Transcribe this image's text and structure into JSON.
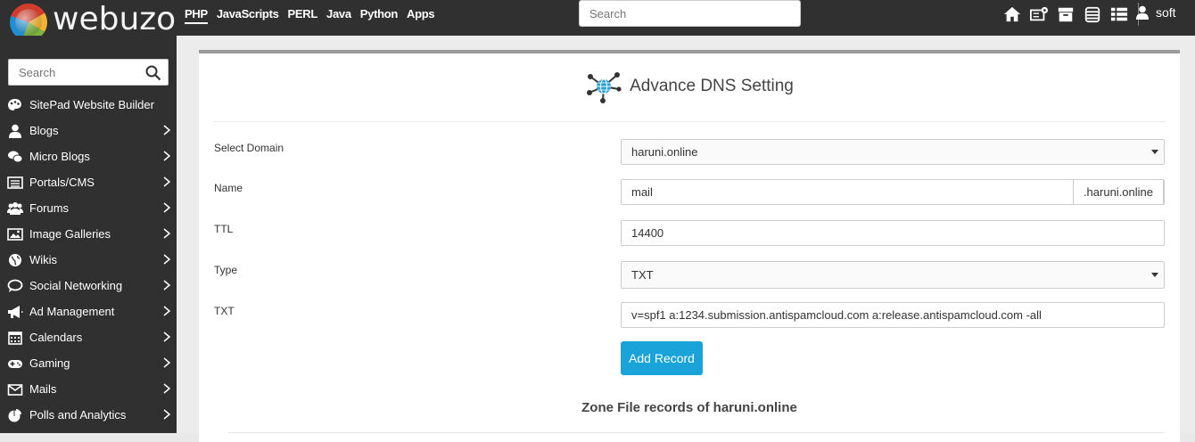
{
  "brand": {
    "name": "webuzo"
  },
  "topnav": {
    "items": [
      {
        "label": "PHP",
        "active": true
      },
      {
        "label": "JavaScripts",
        "active": false
      },
      {
        "label": "PERL",
        "active": false
      },
      {
        "label": "Java",
        "active": false
      },
      {
        "label": "Python",
        "active": false
      },
      {
        "label": "Apps",
        "active": false
      }
    ],
    "search_placeholder": "Search",
    "icons": [
      "home-icon",
      "server-config-icon",
      "archive-box-icon",
      "database-icon",
      "list-icon"
    ],
    "user": {
      "name": "soft",
      "icon": "user-icon"
    }
  },
  "sidebar": {
    "search_placeholder": "Search",
    "items": [
      {
        "label": "SitePad Website Builder",
        "icon": "palette-icon",
        "has_children": false
      },
      {
        "label": "Blogs",
        "icon": "user-icon",
        "has_children": true
      },
      {
        "label": "Micro Blogs",
        "icon": "chat-icon",
        "has_children": true
      },
      {
        "label": "Portals/CMS",
        "icon": "list-box-icon",
        "has_children": true
      },
      {
        "label": "Forums",
        "icon": "users-icon",
        "has_children": true
      },
      {
        "label": "Image Galleries",
        "icon": "image-icon",
        "has_children": true
      },
      {
        "label": "Wikis",
        "icon": "globe-icon",
        "has_children": true
      },
      {
        "label": "Social Networking",
        "icon": "comment-icon",
        "has_children": true
      },
      {
        "label": "Ad Management",
        "icon": "megaphone-icon",
        "has_children": true
      },
      {
        "label": "Calendars",
        "icon": "calendar-icon",
        "has_children": true
      },
      {
        "label": "Gaming",
        "icon": "gamepad-icon",
        "has_children": true
      },
      {
        "label": "Mails",
        "icon": "envelope-icon",
        "has_children": true
      },
      {
        "label": "Polls and Analytics",
        "icon": "pie-chart-icon",
        "has_children": true
      }
    ]
  },
  "page": {
    "title": "Advance DNS Setting",
    "title_icon": "network-globe-icon",
    "form": {
      "domain_label": "Select Domain",
      "domain_value": "haruni.online",
      "name_label": "Name",
      "name_value": "mail",
      "name_suffix": ".haruni.online",
      "ttl_label": "TTL",
      "ttl_value": "14400",
      "type_label": "Type",
      "type_value": "TXT",
      "txt_label": "TXT",
      "txt_value": "v=spf1 a:1234.submission.antispamcloud.com a:release.antispamcloud.com -all",
      "submit_label": "Add Record"
    },
    "zone_title": "Zone File records of haruni.online"
  },
  "colors": {
    "topbar": "#303030",
    "sidebar": "#303030",
    "accent_button": "#1aa3d9",
    "panel_border": "#9a9a9a"
  }
}
